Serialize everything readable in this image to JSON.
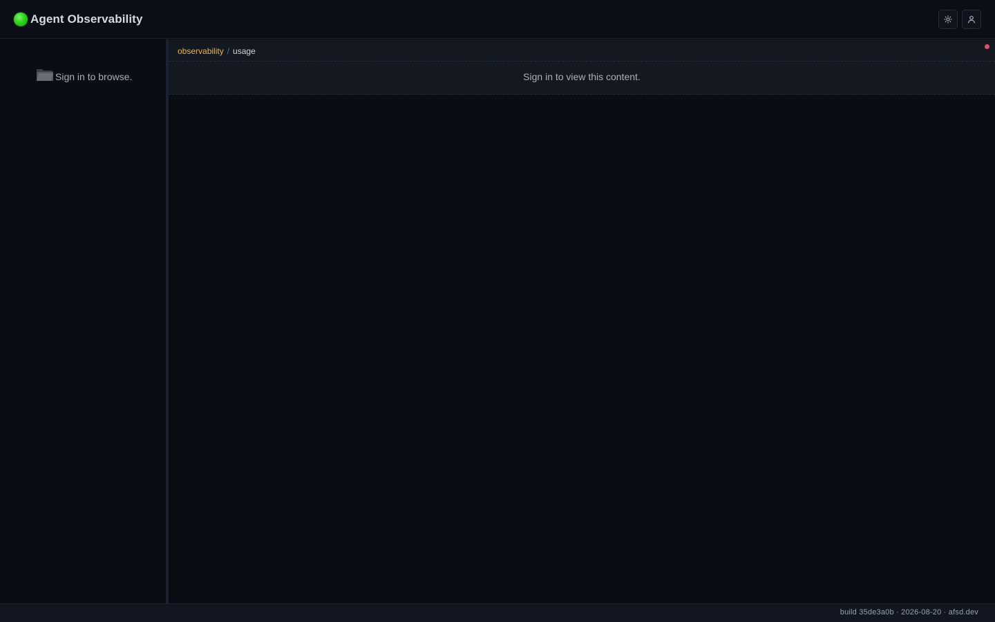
{
  "header": {
    "title": "Agent Observability",
    "theme_toggle_icon": "sun-icon",
    "account_icon": "user-icon",
    "brand_color": "#2fd01f"
  },
  "sidebar": {
    "empty_icon": "folder-icon",
    "empty_text": "Sign in to browse."
  },
  "main": {
    "breadcrumb": {
      "parent": "observability",
      "separator": "/",
      "current": "usage"
    },
    "message": "Sign in to view this content.",
    "status_indicator_color": "#e2505f",
    "accent_color": "#e8b64a"
  },
  "footer": {
    "text": "build 35de3a0b · 2026-08-20 · afsd.dev"
  }
}
